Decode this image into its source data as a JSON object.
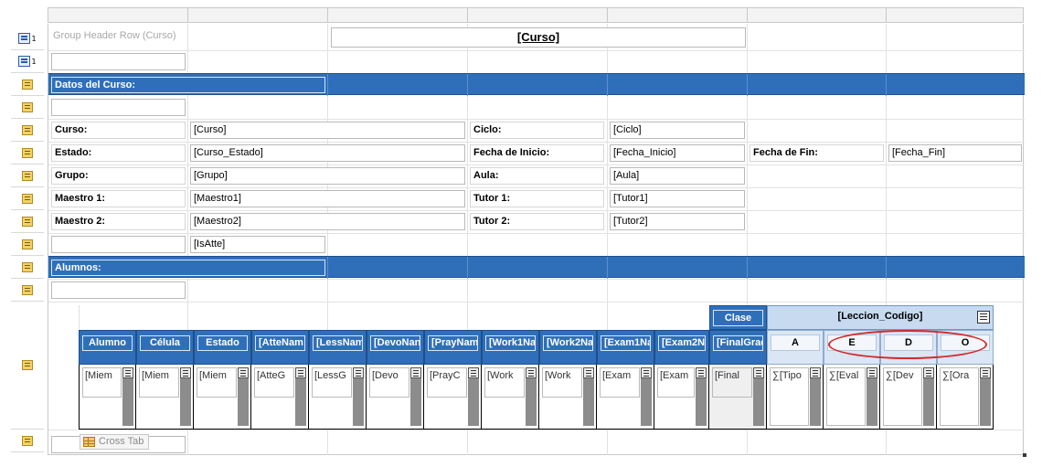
{
  "group_header": {
    "placeholder_text": "Group Header Row (Curso)",
    "title_field": "[Curso]",
    "group_level_1": "1",
    "group_level_2": "1"
  },
  "sections": {
    "datos_del_curso": "Datos del Curso:",
    "alumnos": "Alumnos:"
  },
  "fields": [
    {
      "label": "Curso:",
      "value": "[Curso]",
      "label2": "Ciclo:",
      "value2": "[Ciclo]"
    },
    {
      "label": "Estado:",
      "value": "[Curso_Estado]",
      "label2": "Fecha de Inicio:",
      "value2": "[Fecha_Inicio]",
      "label3": "Fecha de Fin:",
      "value3": "[Fecha_Fin]"
    },
    {
      "label": "Grupo:",
      "value": "[Grupo]",
      "label2": "Aula:",
      "value2": "[Aula]"
    },
    {
      "label": "Maestro 1:",
      "value": "[Maestro1]",
      "label2": "Tutor 1:",
      "value2": "[Tutor1]"
    },
    {
      "label": "Maestro 2:",
      "value": "[Maestro2]",
      "label2": "Tutor 2:",
      "value2": "[Tutor2]"
    }
  ],
  "is_atte": "[IsAtte]",
  "crosstab": {
    "tag_label": "Cross Tab",
    "row_headers": [
      "Alumno",
      "Célula",
      "Estado",
      "[AtteNam",
      "[LessNam",
      "[DevoNan",
      "[PrayNam",
      "[Work1Na",
      "[Work2Na",
      "[Exam1Na",
      "[Exam2Na",
      "[FinalGrad"
    ],
    "row_values": [
      "[Miem",
      "[Miem",
      "[Miem",
      "[AtteG",
      "[LessG",
      "[Devo",
      "[PrayC",
      "[Work",
      "[Work",
      "[Exam",
      "[Exam",
      "[Final"
    ],
    "column_group_label": "Clase",
    "column_header": "[Leccion_Codigo]",
    "column_values": [
      "A",
      "E",
      "D",
      "O"
    ],
    "cell_values": [
      "∑[Tipo",
      "∑[Eval",
      "∑[Dev",
      "∑[Ora"
    ]
  },
  "colors": {
    "banner": "#2f6fba",
    "annotation": "#d42a2a"
  }
}
